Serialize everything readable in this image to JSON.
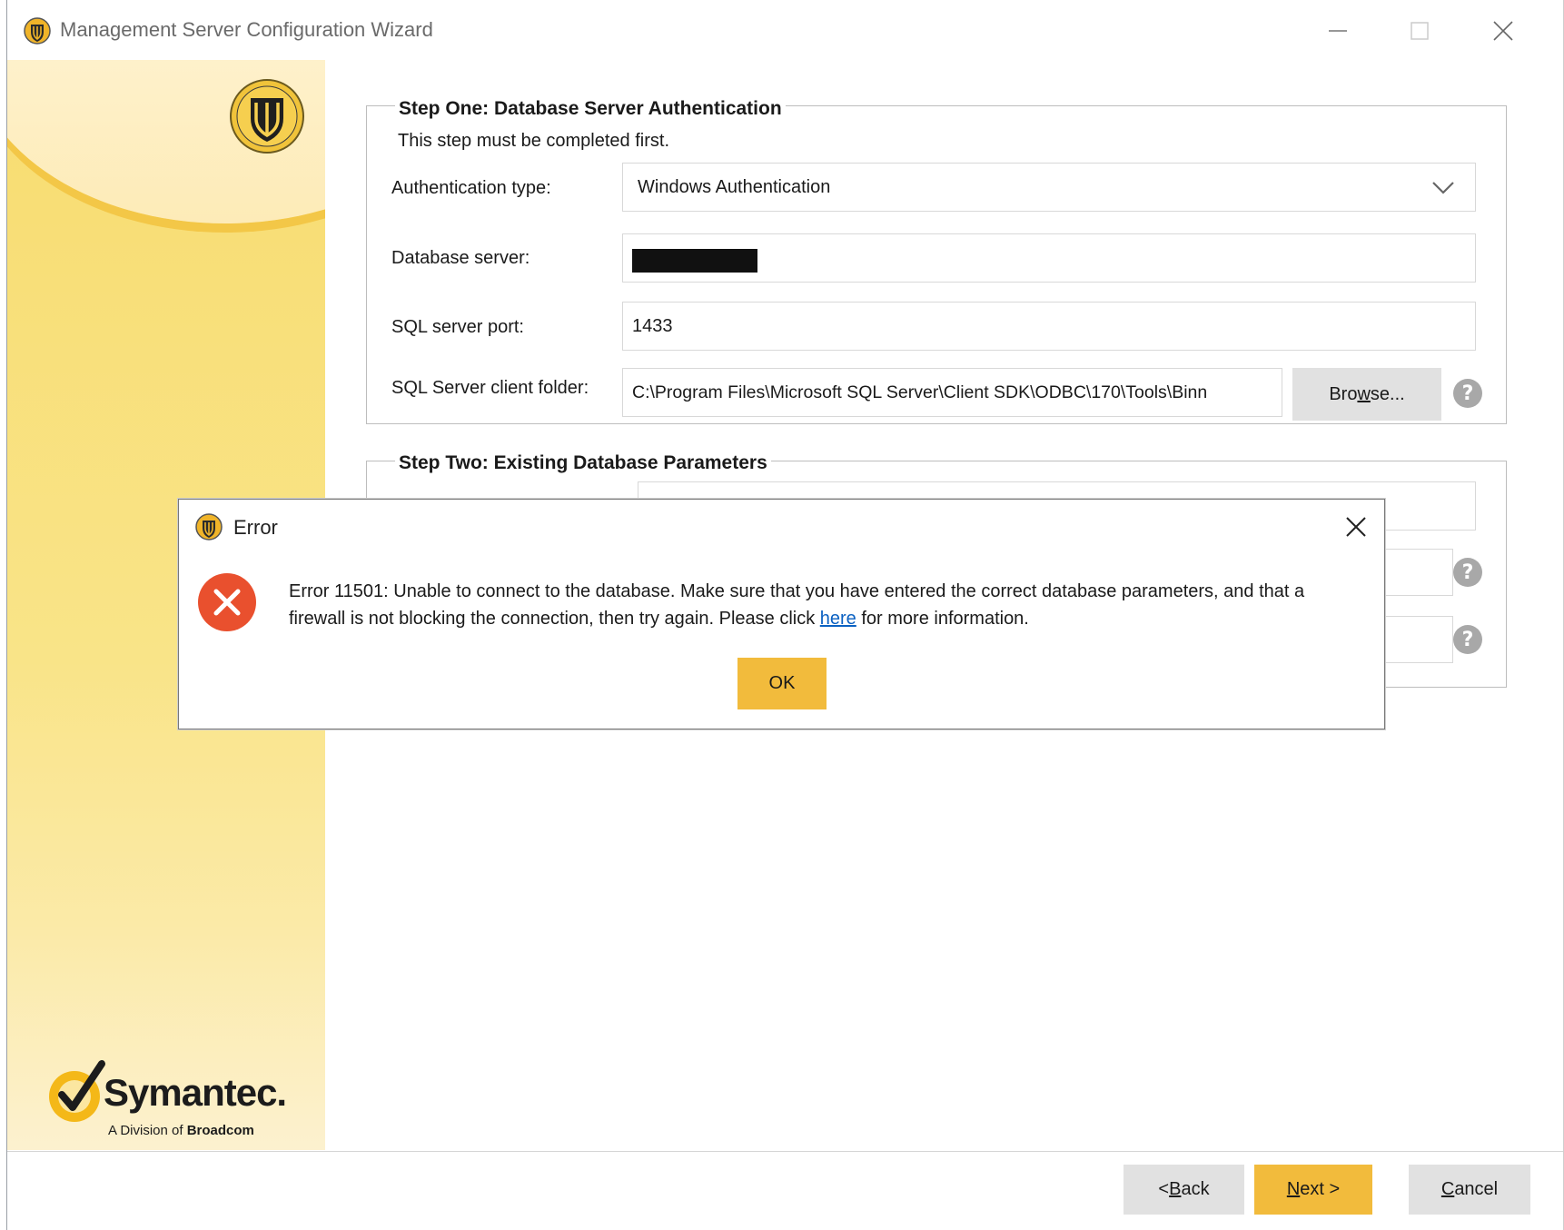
{
  "window": {
    "title": "Management Server Configuration Wizard",
    "controls": [
      "minimize",
      "maximize",
      "close"
    ]
  },
  "branding": {
    "wordmark": "Symantec.",
    "subtitle_prefix": "A Division of ",
    "subtitle_bold": "Broadcom"
  },
  "step_one": {
    "legend": "Step One: Database Server Authentication",
    "note": "This step must be completed first.",
    "auth_type_label": "Authentication type:",
    "auth_type_value": "Windows Authentication",
    "db_server_label": "Database server:",
    "db_server_value": "",
    "port_label": "SQL server port:",
    "port_value": "1433",
    "client_folder_label": "SQL Server client folder:",
    "client_folder_value": "C:\\Program Files\\Microsoft SQL Server\\Client SDK\\ODBC\\170\\Tools\\Binn",
    "browse_pre": "Bro",
    "browse_u": "w",
    "browse_post": "se...",
    "help_glyph": "?"
  },
  "step_two": {
    "legend": "Step Two: Existing Database Parameters",
    "help_glyph": "?"
  },
  "footer": {
    "back_pre": "< ",
    "back_u": "B",
    "back_post": "ack",
    "next_u": "N",
    "next_post": "ext >",
    "cancel_u": "C",
    "cancel_post": "ancel"
  },
  "error_dialog": {
    "title": "Error",
    "message_part1": "Error 11501: Unable to connect to the database. Make sure that you have entered the correct database parameters, and that a firewall is not blocking the connection, then try again. Please click ",
    "link_text": "here",
    "message_part2": " for more information.",
    "ok_label": "OK"
  },
  "colors": {
    "accent": "#f2bb3c",
    "error_red": "#e9502e",
    "link": "#0b61c2",
    "button_gray": "#e1e1e1"
  },
  "icons": [
    "shield-icon",
    "error-x-icon",
    "chevron-down-icon",
    "help-icon",
    "symantec-check-icon"
  ]
}
